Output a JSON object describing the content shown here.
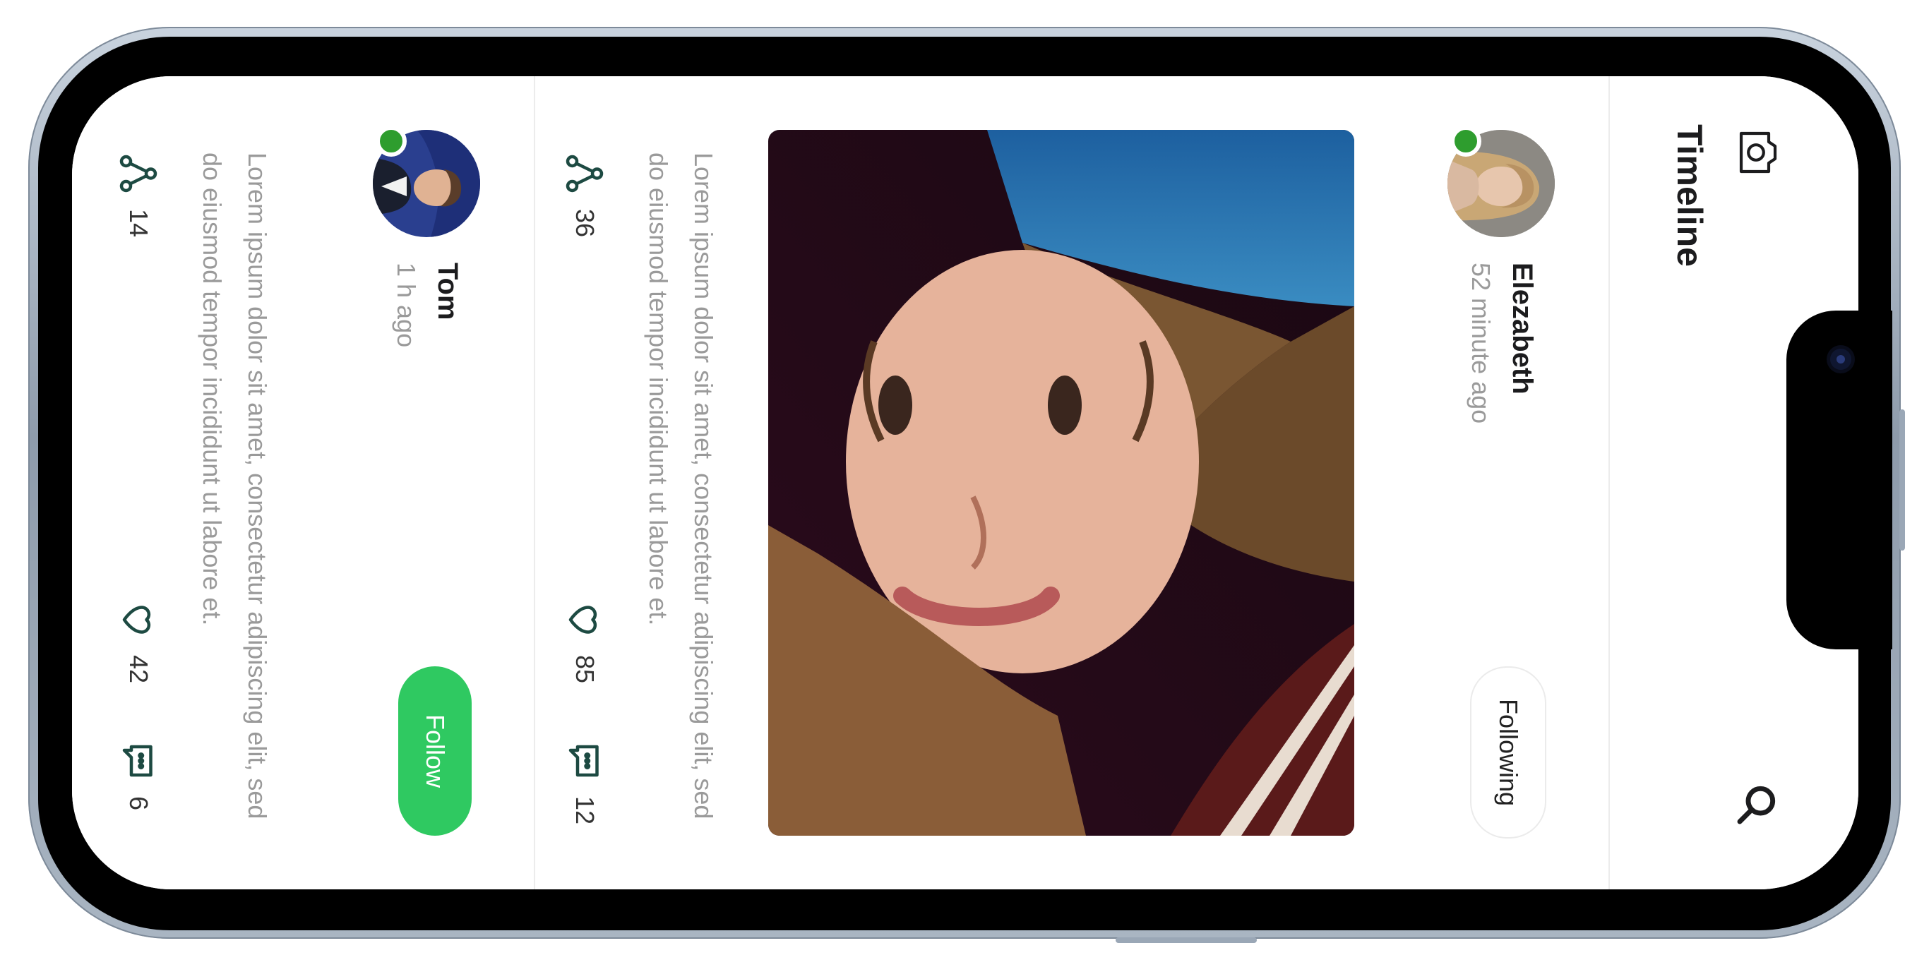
{
  "header": {
    "title": "Timeline",
    "left_icon": "camera-icon",
    "right_icon": "search-icon"
  },
  "posts": [
    {
      "user": "Elezabeth",
      "time": "52 minute ago",
      "online": true,
      "action_label": "Following",
      "has_image": true,
      "text": "Lorem ipsum dolor sit amet, consectetur adipiscing elit, sed do eiusmod tempor incididunt ut labore et.",
      "shares": "36",
      "likes": "85",
      "comments": "12"
    },
    {
      "user": "Tom",
      "time": "1 h ago",
      "online": true,
      "action_label": "Follow",
      "has_image": false,
      "text": "Lorem ipsum dolor sit amet, consectetur adipiscing elit, sed do eiusmod tempor incididunt ut labore et.",
      "shares": "14",
      "likes": "42",
      "comments": "6"
    }
  ],
  "colors": {
    "accent_green": "#2fc961",
    "online": "#2e9d2e",
    "icon_stroke": "#1d4a42",
    "frame": "#a9b5c2"
  }
}
